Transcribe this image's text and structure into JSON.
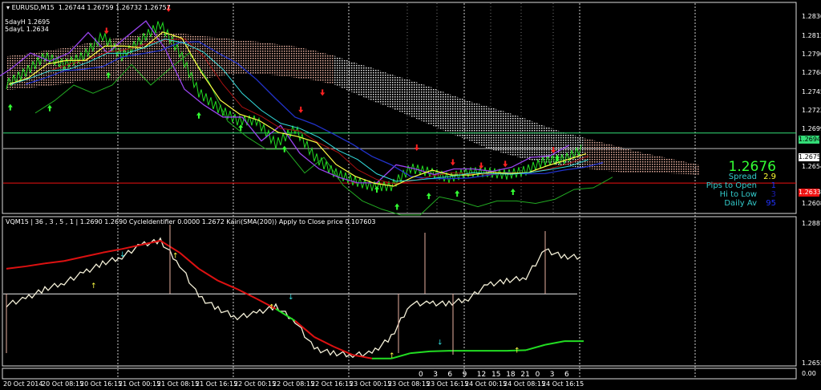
{
  "header": {
    "symbol": "EURUSD,M15",
    "open": "1.26744",
    "high": "1.26759",
    "low": "1.26732",
    "close": "1.26757"
  },
  "five_day": {
    "high_label": "5dayH 1.2695",
    "low_label": "5dayL 1.2634"
  },
  "indicator_header": "VQM15 | 36 , 3 , 5 , 1 |  1.2690 1.2690  CycleIdentifier 0.0000 1.2672  Kairi(SMA(200)) Apply to Close price 0.107603",
  "info_panel": {
    "price": "1.2676",
    "spread_label": "Spread",
    "spread": "2.9",
    "pips_label": "Pips to Open",
    "pips": "1",
    "hilo_label": "Hi to Low",
    "hilo": "3",
    "daily_label": "Daily Av",
    "daily": "95"
  },
  "colors": {
    "price": "#33ff33",
    "label": "#33cccc",
    "spread": "#ffff33",
    "value_blue": "#2233ff",
    "hilo": "#1a1aaa",
    "up": "#33ff33",
    "down": "#ff2222",
    "ma_up": "#22dd22",
    "ma_down": "#dd1111"
  },
  "price_axis": [
    "1.28360",
    "1.28135",
    "1.27905",
    "1.27680",
    "1.27450",
    "1.27225",
    "1.26995",
    "1.26540",
    "1.26085"
  ],
  "price_tags": [
    {
      "value": "1.26947",
      "color": "#33dd77"
    },
    {
      "value": "1.26757",
      "color": "#ffffff"
    },
    {
      "value": "1.26338",
      "color": "#ee1111"
    }
  ],
  "indicator_axis": [
    "1.2887",
    "1.2655"
  ],
  "hours_axis": {
    "labels": [
      "0",
      "3",
      "6",
      "9",
      "12",
      "15",
      "18",
      "21",
      "0",
      "3",
      "6"
    ],
    "scale": "0.00"
  },
  "time_axis": [
    "20 Oct 2014",
    "20 Oct 08:15",
    "20 Oct 16:15",
    "21 Oct 00:15",
    "21 Oct 08:15",
    "21 Oct 16:15",
    "22 Oct 00:15",
    "22 Oct 08:15",
    "22 Oct 16:15",
    "23 Oct 00:15",
    "23 Oct 08:15",
    "23 Oct 16:15",
    "24 Oct 00:15",
    "24 Oct 08:15",
    "24 Oct 16:15"
  ],
  "chart_data": [
    {
      "type": "line",
      "title": "EURUSD,M15",
      "x_unit": "hours from 20 Oct 2014 00:00",
      "step_hours": 4,
      "ylim": [
        1.2597,
        1.2853
      ],
      "close": [
        1.2754,
        1.2769,
        1.2788,
        1.2778,
        1.2788,
        1.2813,
        1.2788,
        1.2808,
        1.2827,
        1.2793,
        1.2744,
        1.2725,
        1.271,
        1.271,
        1.2681,
        1.27,
        1.2666,
        1.2647,
        1.2637,
        1.263,
        1.263,
        1.2652,
        1.2647,
        1.264,
        1.2647,
        1.2647,
        1.2644,
        1.2649,
        1.2661,
        1.2663,
        1.2676
      ],
      "cloud_top": [
        1.2788,
        1.2791,
        1.2795,
        1.2798,
        1.2803,
        1.2807,
        1.2811,
        1.2815,
        1.2818,
        1.2816,
        1.2813,
        1.2811,
        1.2808,
        1.2806,
        1.2803,
        1.28,
        1.2795,
        1.2789,
        1.2781,
        1.2774,
        1.2766,
        1.2759,
        1.2751,
        1.2742,
        1.2734,
        1.2727,
        1.272,
        1.2712,
        1.2703,
        1.2695,
        1.2689,
        1.2683,
        1.2677,
        1.2671,
        1.2666,
        1.2661,
        1.2656
      ],
      "cloud_bottom": [
        1.2747,
        1.2749,
        1.2752,
        1.2754,
        1.2759,
        1.2759,
        1.2759,
        1.2759,
        1.2759,
        1.2759,
        1.2759,
        1.2764,
        1.2767,
        1.2767,
        1.2765,
        1.2762,
        1.2759,
        1.2754,
        1.2744,
        1.2734,
        1.2725,
        1.2715,
        1.2705,
        1.2695,
        1.2686,
        1.2676,
        1.2669,
        1.2663,
        1.2658,
        1.2655,
        1.2652,
        1.2649,
        1.2647,
        1.2647,
        1.2646,
        1.2645,
        1.2644
      ],
      "hlines": [
        {
          "value": 1.26947,
          "color": "#33dd77"
        },
        {
          "value": 1.26757,
          "color": "#bbbbbb"
        },
        {
          "value": 1.26338,
          "color": "#ee1111"
        }
      ],
      "up_signals": [
        [
          0.8,
          1.273
        ],
        [
          9,
          1.2729
        ],
        [
          21.2,
          1.2769
        ],
        [
          40,
          1.272
        ],
        [
          48.7,
          1.2705
        ],
        [
          57.8,
          1.2679
        ],
        [
          77,
          1.263
        ],
        [
          81.2,
          1.2609
        ],
        [
          87.8,
          1.2622
        ],
        [
          93.7,
          1.2625
        ],
        [
          105.3,
          1.2627
        ],
        [
          114.5,
          1.2668
        ]
      ],
      "down_signals": [
        [
          33.7,
          1.2842
        ],
        [
          20.8,
          1.2815
        ],
        [
          61.2,
          1.2719
        ],
        [
          65.7,
          1.274
        ],
        [
          85.3,
          1.2673
        ],
        [
          92.8,
          1.2655
        ],
        [
          98.7,
          1.2651
        ],
        [
          103.7,
          1.2653
        ],
        [
          113.7,
          1.267
        ]
      ]
    },
    {
      "type": "line",
      "title": "VQM15",
      "step_hours": 4,
      "ylim": [
        1.2887,
        1.2655
      ],
      "price": [
        1.2752,
        1.2762,
        1.2778,
        1.2789,
        1.2805,
        1.2821,
        1.2832,
        1.2852,
        1.2859,
        1.2819,
        1.2765,
        1.2745,
        1.2731,
        1.2738,
        1.2749,
        1.2725,
        1.2678,
        1.2671,
        1.2668,
        1.2671,
        1.2698,
        1.2754,
        1.2754,
        1.2754,
        1.2762,
        1.2785,
        1.2792,
        1.2798,
        1.2843,
        1.2832,
        1.2832
      ],
      "vqm": [
        1.2812,
        1.2816,
        1.2821,
        1.2825,
        1.2832,
        1.2839,
        1.2845,
        1.2852,
        1.2859,
        1.2839,
        1.2812,
        1.2792,
        1.2778,
        1.2762,
        1.2745,
        1.2725,
        1.2698,
        1.2682,
        1.2668,
        1.2662,
        1.2662,
        1.2671,
        1.2674,
        1.2675,
        1.2675,
        1.2675,
        1.2675,
        1.2676,
        1.2685,
        1.2691,
        1.2691
      ],
      "zero_line": 1.277
    }
  ]
}
